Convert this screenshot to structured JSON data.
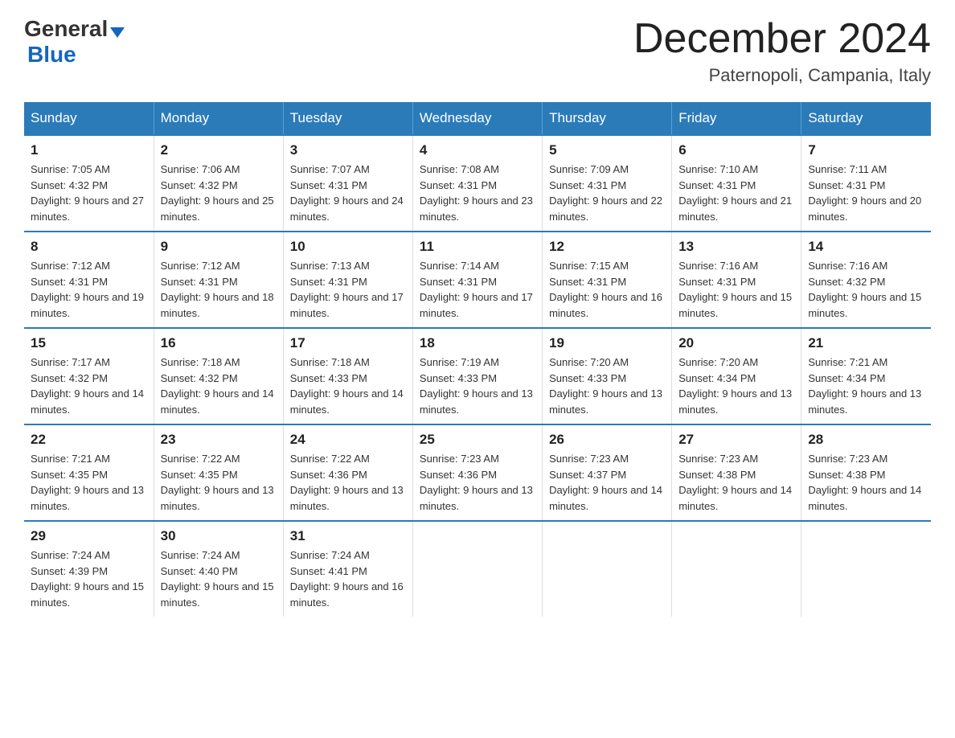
{
  "logo": {
    "general": "General",
    "arrow": "▼",
    "blue": "Blue"
  },
  "title": "December 2024",
  "location": "Paternopoli, Campania, Italy",
  "weekdays": [
    "Sunday",
    "Monday",
    "Tuesday",
    "Wednesday",
    "Thursday",
    "Friday",
    "Saturday"
  ],
  "weeks": [
    [
      {
        "day": "1",
        "sunrise": "7:05 AM",
        "sunset": "4:32 PM",
        "daylight": "9 hours and 27 minutes."
      },
      {
        "day": "2",
        "sunrise": "7:06 AM",
        "sunset": "4:32 PM",
        "daylight": "9 hours and 25 minutes."
      },
      {
        "day": "3",
        "sunrise": "7:07 AM",
        "sunset": "4:31 PM",
        "daylight": "9 hours and 24 minutes."
      },
      {
        "day": "4",
        "sunrise": "7:08 AM",
        "sunset": "4:31 PM",
        "daylight": "9 hours and 23 minutes."
      },
      {
        "day": "5",
        "sunrise": "7:09 AM",
        "sunset": "4:31 PM",
        "daylight": "9 hours and 22 minutes."
      },
      {
        "day": "6",
        "sunrise": "7:10 AM",
        "sunset": "4:31 PM",
        "daylight": "9 hours and 21 minutes."
      },
      {
        "day": "7",
        "sunrise": "7:11 AM",
        "sunset": "4:31 PM",
        "daylight": "9 hours and 20 minutes."
      }
    ],
    [
      {
        "day": "8",
        "sunrise": "7:12 AM",
        "sunset": "4:31 PM",
        "daylight": "9 hours and 19 minutes."
      },
      {
        "day": "9",
        "sunrise": "7:12 AM",
        "sunset": "4:31 PM",
        "daylight": "9 hours and 18 minutes."
      },
      {
        "day": "10",
        "sunrise": "7:13 AM",
        "sunset": "4:31 PM",
        "daylight": "9 hours and 17 minutes."
      },
      {
        "day": "11",
        "sunrise": "7:14 AM",
        "sunset": "4:31 PM",
        "daylight": "9 hours and 17 minutes."
      },
      {
        "day": "12",
        "sunrise": "7:15 AM",
        "sunset": "4:31 PM",
        "daylight": "9 hours and 16 minutes."
      },
      {
        "day": "13",
        "sunrise": "7:16 AM",
        "sunset": "4:31 PM",
        "daylight": "9 hours and 15 minutes."
      },
      {
        "day": "14",
        "sunrise": "7:16 AM",
        "sunset": "4:32 PM",
        "daylight": "9 hours and 15 minutes."
      }
    ],
    [
      {
        "day": "15",
        "sunrise": "7:17 AM",
        "sunset": "4:32 PM",
        "daylight": "9 hours and 14 minutes."
      },
      {
        "day": "16",
        "sunrise": "7:18 AM",
        "sunset": "4:32 PM",
        "daylight": "9 hours and 14 minutes."
      },
      {
        "day": "17",
        "sunrise": "7:18 AM",
        "sunset": "4:33 PM",
        "daylight": "9 hours and 14 minutes."
      },
      {
        "day": "18",
        "sunrise": "7:19 AM",
        "sunset": "4:33 PM",
        "daylight": "9 hours and 13 minutes."
      },
      {
        "day": "19",
        "sunrise": "7:20 AM",
        "sunset": "4:33 PM",
        "daylight": "9 hours and 13 minutes."
      },
      {
        "day": "20",
        "sunrise": "7:20 AM",
        "sunset": "4:34 PM",
        "daylight": "9 hours and 13 minutes."
      },
      {
        "day": "21",
        "sunrise": "7:21 AM",
        "sunset": "4:34 PM",
        "daylight": "9 hours and 13 minutes."
      }
    ],
    [
      {
        "day": "22",
        "sunrise": "7:21 AM",
        "sunset": "4:35 PM",
        "daylight": "9 hours and 13 minutes."
      },
      {
        "day": "23",
        "sunrise": "7:22 AM",
        "sunset": "4:35 PM",
        "daylight": "9 hours and 13 minutes."
      },
      {
        "day": "24",
        "sunrise": "7:22 AM",
        "sunset": "4:36 PM",
        "daylight": "9 hours and 13 minutes."
      },
      {
        "day": "25",
        "sunrise": "7:23 AM",
        "sunset": "4:36 PM",
        "daylight": "9 hours and 13 minutes."
      },
      {
        "day": "26",
        "sunrise": "7:23 AM",
        "sunset": "4:37 PM",
        "daylight": "9 hours and 14 minutes."
      },
      {
        "day": "27",
        "sunrise": "7:23 AM",
        "sunset": "4:38 PM",
        "daylight": "9 hours and 14 minutes."
      },
      {
        "day": "28",
        "sunrise": "7:23 AM",
        "sunset": "4:38 PM",
        "daylight": "9 hours and 14 minutes."
      }
    ],
    [
      {
        "day": "29",
        "sunrise": "7:24 AM",
        "sunset": "4:39 PM",
        "daylight": "9 hours and 15 minutes."
      },
      {
        "day": "30",
        "sunrise": "7:24 AM",
        "sunset": "4:40 PM",
        "daylight": "9 hours and 15 minutes."
      },
      {
        "day": "31",
        "sunrise": "7:24 AM",
        "sunset": "4:41 PM",
        "daylight": "9 hours and 16 minutes."
      },
      null,
      null,
      null,
      null
    ]
  ]
}
